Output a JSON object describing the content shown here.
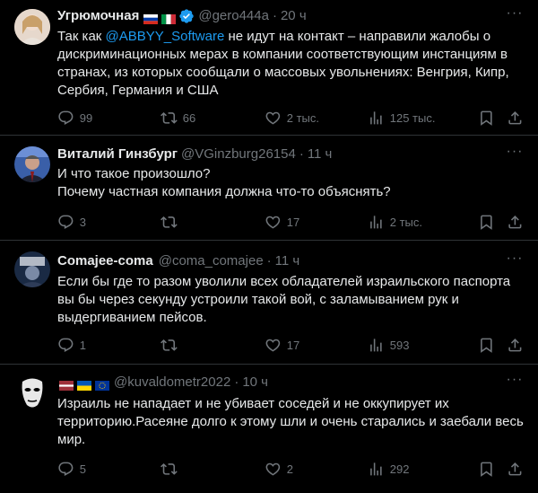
{
  "tweets": [
    {
      "name": "Угрюмочная",
      "handle": "@gero444a",
      "time": "20 ч",
      "text_parts": [
        "Так как ",
        "@ABBYY_Software",
        " не идут на контакт – направили жалобы о дискриминационных мерах в компании соответствующим инстанциям в странах, из которых сообщали о массовых увольнениях: Венгрия, Кипр, Сербия, Германия и США"
      ],
      "replies": "99",
      "retweets": "66",
      "likes": "2 тыс.",
      "views": "125 тыс."
    },
    {
      "name": "Виталий Гинзбург",
      "handle": "@VGinzburg26154",
      "time": "11 ч",
      "text_lines": [
        "И что такое произошло?",
        "Почему частная компания должна что-то объяснять?"
      ],
      "replies": "3",
      "retweets": "",
      "likes": "17",
      "views": "2 тыс."
    },
    {
      "name": "Comajee-coma",
      "handle": "@coma_comajee",
      "time": "11 ч",
      "text": "Если бы где то разом уволили всех обладателей израильского паспорта  вы бы через секунду устроили такой вой, с заламыванием рук и выдергиванием пейсов.",
      "replies": "1",
      "retweets": "",
      "likes": "17",
      "views": "593"
    },
    {
      "name": "",
      "handle": "@kuvaldometr2022",
      "time": "10 ч",
      "text": "Израиль не нападает и не убивает соседей и не оккупирует их территорию.Расеяне долго к этому шли и очень старались и заебали весь мир.",
      "replies": "5",
      "retweets": "",
      "likes": "2",
      "views": "292"
    }
  ],
  "colors": {
    "accent": "#1d9bf0",
    "muted": "#71767b",
    "text": "#e7e9ea",
    "bg": "#000000",
    "border": "#2f3336"
  }
}
